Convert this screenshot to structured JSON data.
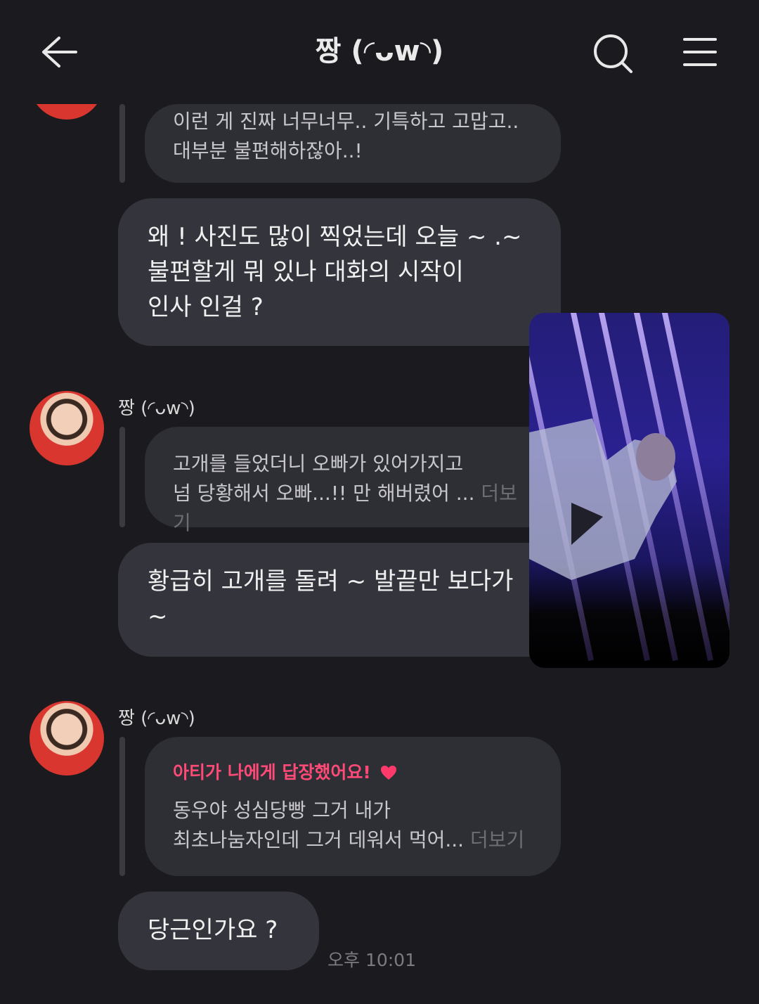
{
  "header": {
    "title": "짱 (◜ᴗw◝)",
    "back_icon": "arrow-left-icon",
    "search_icon": "search-icon",
    "menu_icon": "hamburger-menu-icon"
  },
  "messages": {
    "m1_quote": [
      "이런 게 진짜 너무너무.. 기특하고 고맙고..",
      "대부분 불편해하잖아..!"
    ],
    "m1_reply": [
      "왜 ! 사진도 많이 찍었는데 오늘 ~ .~",
      "불편할게 뭐 있나  대화의 시작이",
      "인사 인걸 ?"
    ],
    "m2_sender": "짱 (◜ᴗw◝)",
    "m2_quote": [
      "고개를 들었더니 오빠가 있어가지고",
      "넘 당황해서 오빠...!! 만 해버렸어 ..."
    ],
    "m2_more": "더보기",
    "m2_reply": [
      "황급히 고개를 돌려 ~ 발끝만 보다가",
      "~"
    ],
    "m3_sender": "짱 (◜ᴗw◝)",
    "m3_reply_head": "아티가 나에게 답장했어요!",
    "m3_quote": [
      "동우야 성심당빵 그거 내가",
      "최초나눔자인데 그거 데워서 먹어..."
    ],
    "m3_more": "더보기",
    "m3_reply": "당근인가요 ?",
    "m3_time": "오후 10:01"
  },
  "colors": {
    "background": "#1b1b1f",
    "bubble": "#34353c",
    "quote_bubble": "#2e2f35",
    "accent_pink": "#ff4a78"
  }
}
